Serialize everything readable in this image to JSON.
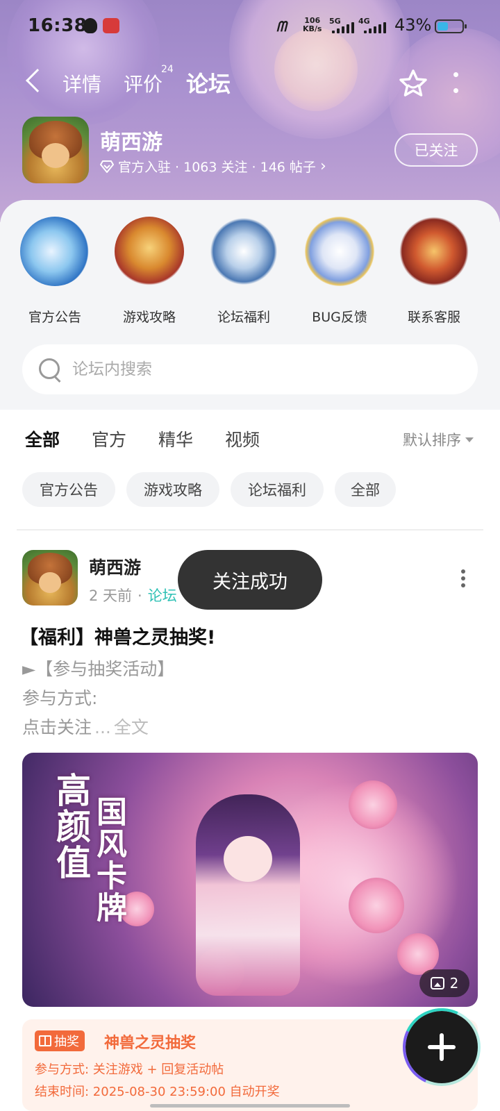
{
  "status_bar": {
    "time": "16:38",
    "speed_value": "106",
    "speed_unit": "KB/s",
    "sim1": "5G",
    "sim2": "4G",
    "battery_text": "43%",
    "battery_level": 0.43
  },
  "top_nav": {
    "tabs": [
      {
        "label": "详情"
      },
      {
        "label": "评价",
        "badge": "24"
      },
      {
        "label": "论坛"
      }
    ],
    "active_tab": "论坛"
  },
  "game": {
    "name": "萌西游",
    "meta": "官方入驻 · 1063 关注 · 146 帖子",
    "follow_label": "已关注"
  },
  "categories": [
    {
      "label": "官方公告"
    },
    {
      "label": "游戏攻略"
    },
    {
      "label": "论坛福利"
    },
    {
      "label": "BUG反馈"
    },
    {
      "label": "联系客服"
    }
  ],
  "search": {
    "placeholder": "论坛内搜索"
  },
  "sub_tabs": [
    {
      "label": "全部"
    },
    {
      "label": "官方"
    },
    {
      "label": "精华"
    },
    {
      "label": "视频"
    }
  ],
  "sort_label": "默认排序",
  "chips": [
    {
      "label": "官方公告"
    },
    {
      "label": "游戏攻略"
    },
    {
      "label": "论坛福利"
    },
    {
      "label": "全部"
    }
  ],
  "post": {
    "author": "萌西游",
    "time_ago": "2 天前",
    "forum": "论坛",
    "title": "【福利】神兽之灵抽奖!",
    "lines": [
      "►【参与抽奖活动】",
      "参与方式:",
      "点击关注"
    ],
    "ellipsis": "...",
    "read_more": "全文",
    "image_text_1": "高颜值",
    "image_text_2": "国风卡牌",
    "image_count": "2"
  },
  "toast": "关注成功",
  "lottery": {
    "tag": "抽奖",
    "title": "神兽之灵抽奖",
    "participation": "参与方式: 关注游戏 + 回复活动帖",
    "end_time": "结束时间: 2025-08-30 23:59:00 自动开奖"
  },
  "colors": {
    "accent": "#2fd3c2",
    "lottery": "#f26a3b",
    "header_bg": "#a890cf"
  }
}
